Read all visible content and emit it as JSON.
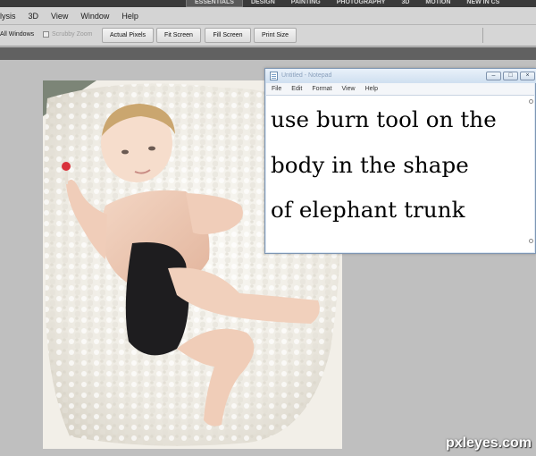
{
  "workspace_tabs": [
    "ESSENTIALS",
    "DESIGN",
    "PAINTING",
    "PHOTOGRAPHY",
    "3D",
    "MOTION",
    "NEW IN CS"
  ],
  "menu_items": [
    "lysis",
    "3D",
    "View",
    "Window",
    "Help"
  ],
  "options": {
    "all_windows_label": "All Windows",
    "scrubby_zoom_label": "Scrubby Zoom",
    "actual_pixels_label": "Actual Pixels",
    "fit_screen_label": "Fit Screen",
    "fill_screen_label": "Fill Screen",
    "print_size_label": "Print Size"
  },
  "notepad": {
    "title": "Untitled - Notepad",
    "menu_items": [
      "File",
      "Edit",
      "Format",
      "View",
      "Help"
    ],
    "lines": [
      "use burn tool on the",
      "body in the shape",
      "of elephant trunk"
    ]
  },
  "watermark": "pxleyes.com",
  "colors": {
    "workspace_bar": "#3a3a3a",
    "menubar": "#d4d4d4",
    "canvas_background": "#bfbfbf",
    "notepad_frame": "#dce7f3"
  }
}
